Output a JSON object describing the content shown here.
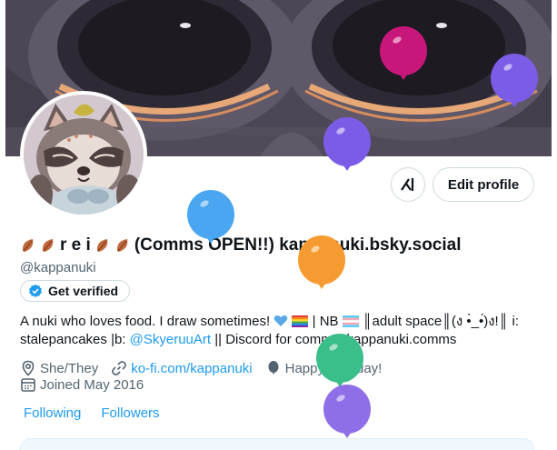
{
  "header": {
    "grok_label": "x̸",
    "edit_profile_label": "Edit profile"
  },
  "profile": {
    "display_name": "r e i",
    "display_name_rest": "(Comms OPEN!!) kappanuki.bsky.social",
    "handle": "@kappanuki",
    "verify_label": "Get verified",
    "bio_line1_a": "A nuki who loves food. I draw sometimes!",
    "bio_line1_b": "| NB",
    "bio_line1_c": "║adult space║(ง •̀_•́)ง!║ i:",
    "bio_line2_a": "stalepancakes |b: ",
    "bio_line2_link": "@SkyeruuArt",
    "bio_line2_b": " || Discord for comms: kappanuki.comms",
    "pronouns": "She/They",
    "website": "ko-fi.com/kappanuki",
    "birthday": "Happy Birthday!",
    "joined": "Joined May 2016",
    "following_label": "Following",
    "followers_label": "Followers"
  },
  "colors": {
    "accent": "#1d9bf0",
    "muted": "#536471",
    "balloon_magenta": "#c8177a",
    "balloon_purple": "#7b5ce6",
    "balloon_blue": "#4aa6f0",
    "balloon_orange": "#f59b32",
    "balloon_green": "#3bbf8a"
  },
  "icons": {
    "pronoun_icon": "location-pin-icon",
    "website_icon": "link-icon",
    "birthday_icon": "balloon-icon",
    "joined_icon": "calendar-icon",
    "verify_icon": "verified-badge-icon"
  }
}
